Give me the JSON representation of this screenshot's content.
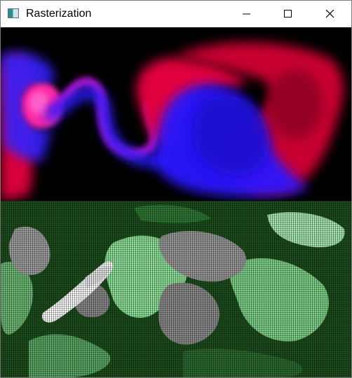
{
  "window": {
    "title": "Rasterization",
    "icon": "app-window-icon",
    "controls": {
      "minimize": "minimize-icon",
      "maximize": "maximize-icon",
      "close": "close-icon"
    }
  },
  "views": {
    "top": {
      "content": "fluid-dye-render",
      "colors": [
        "#e0003c",
        "#2a1cff",
        "#000000"
      ]
    },
    "bottom": {
      "content": "rasterized-ascii-render",
      "colors": [
        "#1d4f1d",
        "#8fe39a",
        "#9a9a9a",
        "#ffffff"
      ]
    }
  }
}
